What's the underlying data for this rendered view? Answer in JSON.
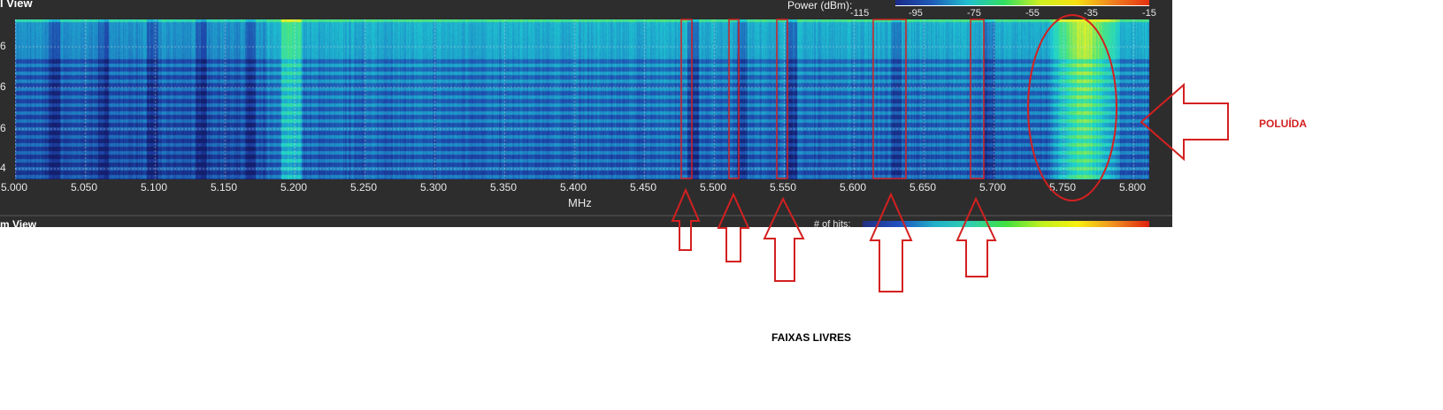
{
  "panel": {
    "title": "l View",
    "lower_title": "m View",
    "x_axis_label": "MHz",
    "x_ticks": [
      "5.000",
      "5.050",
      "5.100",
      "5.150",
      "5.200",
      "5.250",
      "5.300",
      "5.350",
      "5.400",
      "5.450",
      "5.500",
      "5.550",
      "5.600",
      "5.650",
      "5.700",
      "5.750",
      "5.800"
    ],
    "y_ticks": [
      "6",
      "6",
      "6",
      "4"
    ],
    "power_label": "Power (dBm):",
    "power_ticks": [
      "-115",
      "-95",
      "-75",
      "-55",
      "-35",
      "-15"
    ],
    "hits_label": "# of hits:"
  },
  "annotations": {
    "polluted_label": "POLUÍDA",
    "free_bands_label": "FAIXAS LIVRES",
    "color": "#d42020"
  }
}
